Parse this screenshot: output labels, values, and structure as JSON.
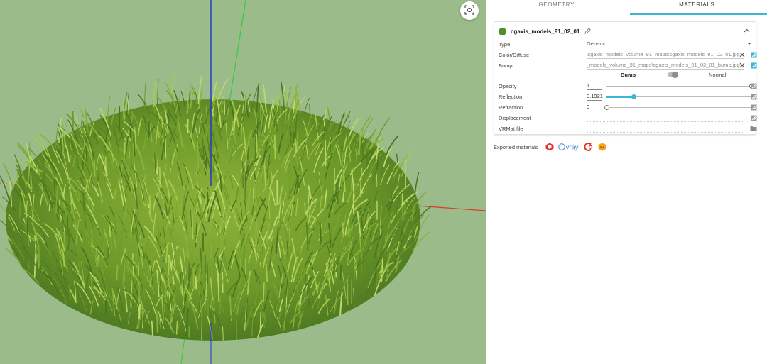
{
  "tabs": [
    {
      "label": "GEOMETRY",
      "active": false
    },
    {
      "label": "MATERIALS",
      "active": true
    }
  ],
  "material": {
    "name": "cgaxis_models_91_02_01",
    "swatch_color": "#4e8f2c",
    "type_label": "Type",
    "type_value": "Generic",
    "color_label": "Color/Diffuse",
    "color_path": "...ps\\cgaxis_models_volume_91_maps\\cgaxis_models_91_02_01.jpg",
    "bump_label": "Bump",
    "bump_path": "...xis_models_volume_91_maps\\cgaxis_models_91_02_01_bump.jpg",
    "bump_mode_option": "Bump",
    "normal_mode_option": "Normal",
    "opacity_label": "Opacity",
    "opacity_value": "1",
    "opacity_fraction": 1.0,
    "reflection_label": "Reflection",
    "reflection_value": "0.1921",
    "reflection_fraction": 0.19,
    "refraction_label": "Refraction",
    "refraction_value": "0",
    "refraction_fraction": 0.0,
    "displacement_label": "Displacement",
    "vrmat_label": "VRMat file"
  },
  "exported": {
    "label": "Exported materials :",
    "vray_text": "v·ray",
    "icons": [
      "sketchup-icon",
      "vray-icon",
      "corona-icon",
      "enscape-icon"
    ]
  },
  "colors": {
    "accent": "#3ab7d4",
    "viewport_bg": "#9bbc8a",
    "axis_red": "#e03a2a",
    "axis_green": "#2ecc40",
    "axis_blue": "#2233cc"
  }
}
